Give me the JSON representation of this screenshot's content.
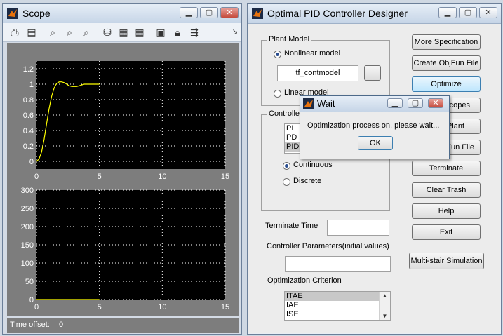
{
  "scope": {
    "title": "Scope",
    "toolbar_icons": [
      "print-icon",
      "parameters-icon",
      "zoom-icon",
      "zoom-x-icon",
      "zoom-y-icon",
      "autoscale-icon",
      "save-axes-icon",
      "restore-axes-icon",
      "floating-scope-icon",
      "lock-axes-icon",
      "signal-selector-icon",
      "dropdown-arrow-icon"
    ],
    "time_offset_label": "Time offset:",
    "time_offset_value": "0"
  },
  "pid": {
    "title": "Optimal PID Controller Designer",
    "plant_model_legend": "Plant Model",
    "nonlinear_label": "Nonlinear model",
    "plant_name": "tf_contmodel",
    "linear_label": "Linear model",
    "controller_legend": "Controller",
    "controller_types": [
      "PI",
      "PD",
      "PID"
    ],
    "controller_selected": "PID",
    "continuous_label": "Continuous",
    "discrete_label": "Discrete",
    "terminate_time_label": "Terminate Time",
    "terminate_time_value": "",
    "controller_params_label": "Controller Parameters(initial values)",
    "controller_params_value": "",
    "criterion_label": "Optimization Criterion",
    "criteria": [
      "ITAE",
      "IAE",
      "ISE"
    ],
    "criterion_selected": "ITAE",
    "buttons": {
      "more_spec": "More Specification",
      "create_objfun": "Create ObjFun File",
      "optimize": "Optimize",
      "open_scopes": "Scopes",
      "open_plant": "Plant",
      "open_objfun": "Fun File",
      "terminate": "Terminate",
      "clear_trash": "Clear Trash",
      "help": "Help",
      "exit": "Exit",
      "multistair": "Multi-stair Simulation"
    }
  },
  "wait_dialog": {
    "title": "Wait",
    "message": "Optimization process on, please wait...",
    "ok_label": "OK"
  },
  "colors": {
    "plot_background": "#000000",
    "trace": "#ffff00",
    "grid": "#ffffff",
    "matlab_orange": "#e8720c"
  },
  "chart_data": [
    {
      "type": "line",
      "title": "",
      "xlim": [
        0,
        15
      ],
      "ylim": [
        -0.1,
        1.3
      ],
      "x_ticks": [
        "0",
        "5",
        "10",
        "15"
      ],
      "y_ticks": [
        "0",
        "0.2",
        "0.4",
        "0.6",
        "0.8",
        "1",
        "1.2"
      ],
      "grid": true,
      "series": [
        {
          "x": [
            0,
            0.2,
            0.4,
            0.6,
            0.8,
            1.0,
            1.2,
            1.4,
            1.6,
            1.8,
            2.0,
            2.2,
            2.4,
            2.6,
            2.8,
            3.0,
            3.2,
            3.4,
            3.6,
            3.8,
            4.0,
            4.2,
            4.4,
            4.6,
            4.8,
            5.0
          ],
          "y": [
            0,
            0.03,
            0.12,
            0.28,
            0.48,
            0.68,
            0.84,
            0.95,
            1.01,
            1.03,
            1.03,
            1.02,
            1.0,
            0.98,
            0.97,
            0.97,
            0.97,
            0.98,
            0.99,
            1.0,
            1.0,
            1.0,
            1.0,
            1.0,
            1.0,
            1.0
          ]
        }
      ]
    },
    {
      "type": "line",
      "title": "",
      "xlim": [
        0,
        15
      ],
      "ylim": [
        0,
        300
      ],
      "x_ticks": [
        "0",
        "5",
        "10",
        "15"
      ],
      "y_ticks": [
        "0",
        "50",
        "100",
        "150",
        "200",
        "250",
        "300"
      ],
      "grid": true,
      "series": [
        {
          "x": [
            0,
            5
          ],
          "y": [
            0,
            0
          ]
        }
      ]
    }
  ]
}
